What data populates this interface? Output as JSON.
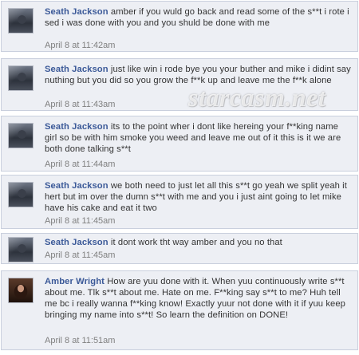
{
  "posts": [
    {
      "author": "Seath Jackson",
      "text": "amber if you wuld go back and read some of the s**t i rote i sed i was done with you and you shuld be done with me",
      "time": "April 8 at 11:42am"
    },
    {
      "author": "Seath Jackson",
      "text": "just like win i rode bye you your buther and mike i didint say nuthing but you did so you grow the f**k up and leave me the f**k alone",
      "time": "April 8 at 11:43am"
    },
    {
      "author": "Seath Jackson",
      "text": "its to the point wher i dont like hereing your f**king name girl so be with him smoke you weed and leave me out of it this is it we are both done talking s**t",
      "time": "April 8 at 11:44am"
    },
    {
      "author": "Seath Jackson",
      "text": "we both need to just let all this s**t go yeah we split yeah it hert but im over the dumn s**t with me and you i just aint going to let mike have his cake and eat it two",
      "time": "April 8 at 11:45am"
    },
    {
      "author": "Seath Jackson",
      "text": "it dont work tht way amber and you no that",
      "time": "April 8 at 11:45am"
    },
    {
      "author": "Amber Wright",
      "text": "How are yuu done with it. When yuu continuously write s**t about me. Tlk s**t about me. Hate on me. F**king say s**t to me? Huh tell me bc i really wanna f**king know! Exactly yuur not done with it if yuu keep bringing my name into s**t! So learn the definition on DONE!",
      "time": "April 8 at 11:51am"
    }
  ],
  "watermark": "starcasm.net"
}
